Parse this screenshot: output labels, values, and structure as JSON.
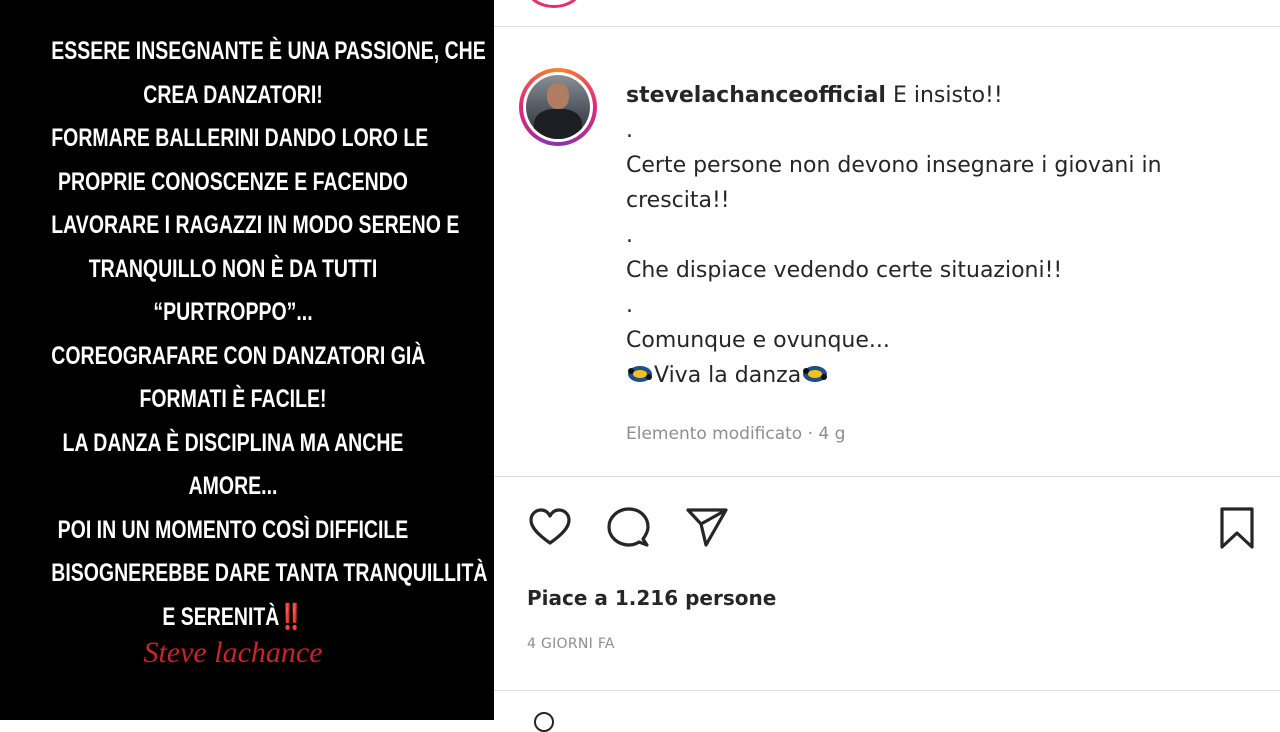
{
  "story": {
    "lines": [
      "ESSERE INSEGNANTE È UNA PASSIONE, CHE",
      "CREA DANZATORI!",
      "FORMARE BALLERINI DANDO LORO LE",
      "PROPRIE CONOSCENZE  E FACENDO",
      "LAVORARE I RAGAZZI IN MODO SERENO E",
      "TRANQUILLO NON È DA TUTTI",
      "“PURTROPPO”...",
      "COREOGRAFARE CON DANZATORI GIÀ",
      "FORMATI È FACILE!",
      "LA DANZA È DISCIPLINA MA ANCHE",
      "AMORE...",
      "POI IN UN MOMENTO COSÌ DIFFICILE",
      "BISOGNEREBBE DARE TANTA TRANQUILLITÀ"
    ],
    "last_line": "E SERENITÀ",
    "last_line_emoji": "‼️",
    "signature": "Steve lachance"
  },
  "post": {
    "username": "stevelachanceofficial",
    "caption_first": "E insisto!!",
    "caption_lines": [
      ".",
      "Certe persone non devono insegnare i giovani in",
      "crescita!!",
      ".",
      "Che dispiace vedendo certe situazioni!!",
      ".",
      "Comunque e ovunque..."
    ],
    "caption_last": "Viva la danza",
    "edited_label": "Elemento modificato · 4 g",
    "likes_label": "Piace a 1.216 persone",
    "time_label": "4 GIORNI FA"
  },
  "icons": {
    "like": "heart-icon",
    "comment": "comment-icon",
    "share": "paper-plane-icon",
    "save": "bookmark-icon",
    "emoji": "dancing-emoji-icon"
  },
  "colors": {
    "story_bg": "#000000",
    "story_text": "#ffffff",
    "signature": "#c8242a",
    "text": "#262626",
    "muted": "#8e8e8e",
    "divider": "#dbdbdb"
  }
}
